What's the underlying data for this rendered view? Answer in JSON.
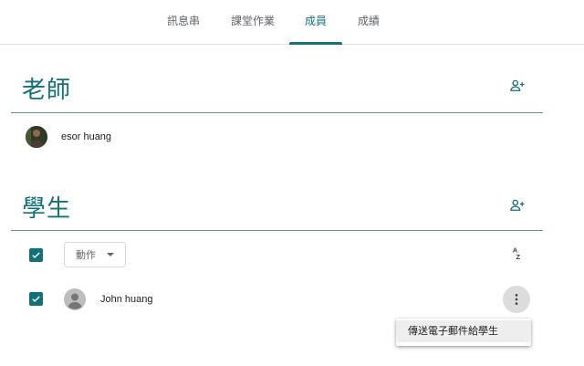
{
  "tabs": [
    {
      "label": "訊息串",
      "active": false
    },
    {
      "label": "課堂作業",
      "active": false
    },
    {
      "label": "成員",
      "active": true
    },
    {
      "label": "成績",
      "active": false
    }
  ],
  "teachers": {
    "title": "老師",
    "people": [
      {
        "name": "esor huang"
      }
    ]
  },
  "students": {
    "title": "學生",
    "actions_label": "動作",
    "people": [
      {
        "name": "John huang",
        "checked": true
      }
    ]
  },
  "context_menu": {
    "items": [
      "傳送電子郵件給學生"
    ]
  },
  "colors": {
    "accent": "#137179",
    "divider": "#137179",
    "menu_hover": "#eeeeee"
  },
  "icons": {
    "invite_teacher": "person-add-icon",
    "invite_student": "person-add-icon",
    "sort": "sort-az-icon",
    "more": "more-vert-icon",
    "dropdown": "caret-down-icon",
    "default_avatar": "account-circle-icon"
  }
}
